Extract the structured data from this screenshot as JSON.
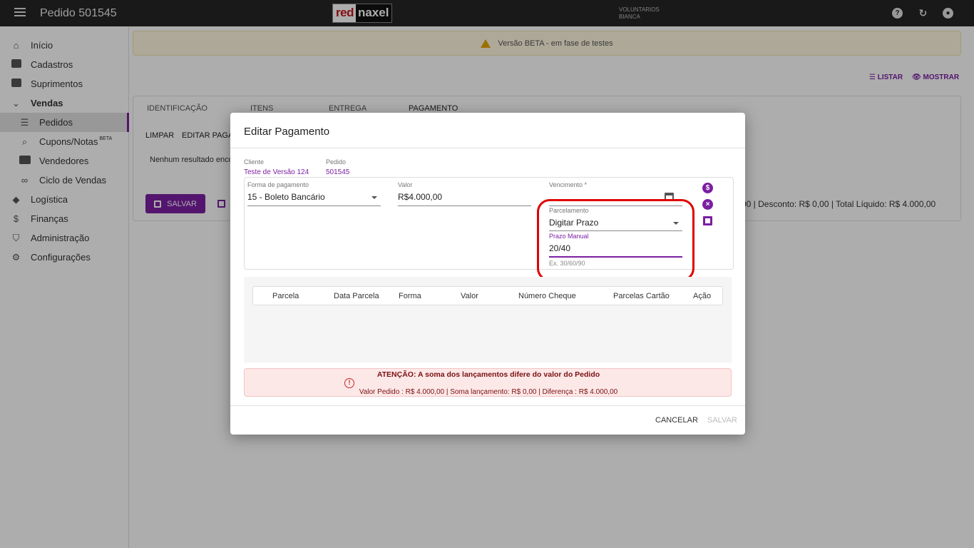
{
  "header": {
    "title": "Pedido 501545",
    "logo_red": "red",
    "logo_naxel": "naxel",
    "user_org": "VOLUNTARIOS",
    "user_name": "BIANCA",
    "icons": [
      "help-icon",
      "refresh-icon",
      "account-icon"
    ]
  },
  "sidebar": {
    "items": [
      {
        "label": "Início"
      },
      {
        "label": "Cadastros"
      },
      {
        "label": "Suprimentos"
      },
      {
        "label": "Vendas"
      },
      {
        "label": "Pedidos"
      },
      {
        "label": "Cupons/Notas",
        "badge": "BETA"
      },
      {
        "label": "Vendedores"
      },
      {
        "label": "Ciclo de Vendas"
      },
      {
        "label": "Logística"
      },
      {
        "label": "Finanças"
      },
      {
        "label": "Administração"
      },
      {
        "label": "Configurações"
      }
    ]
  },
  "banner": {
    "text": "Versão BETA - em fase de testes"
  },
  "actions": {
    "listar": "LISTAR",
    "mostrar": "MOSTRAR"
  },
  "tabs": [
    "IDENTIFICAÇÃO",
    "ITENS",
    "ENTREGA",
    "PAGAMENTO"
  ],
  "subactions": {
    "limpar": "LIMPAR",
    "editar": "EDITAR PAGA"
  },
  "main": {
    "no_result": "Nenhum resultado enco",
    "save_label": "SALVAR",
    "totals": "00 | Desconto: R$ 0,00 | Total Líquido: R$ 4.000,00"
  },
  "modal": {
    "title": "Editar Pagamento",
    "cliente_label": "Cliente",
    "cliente_value": "Teste de Versão 124",
    "pedido_label": "Pedido",
    "pedido_value": "501545",
    "forma_label": "Forma de pagamento",
    "forma_value": "15 - Boleto Bancário",
    "valor_label": "Valor",
    "valor_value": "R$4.000,00",
    "vencimento_label": "Vencimento *",
    "parcelamento_label": "Parcelamento",
    "parcelamento_value": "Digitar Prazo",
    "prazo_label": "Prazo Manual",
    "prazo_value": "20/40",
    "prazo_hint": "Ex. 30/60/90",
    "columns": [
      "Parcela",
      "Data Parcela",
      "Forma",
      "Valor",
      "Número Cheque",
      "Parcelas Cartão",
      "Ação"
    ],
    "alert_title": "ATENÇÃO: A soma dos lançamentos difere do valor do Pedido",
    "alert_text": "Valor Pedido : R$ 4.000,00 | Soma lançamento: R$ 0,00 | Diferença : R$ 4.000,00",
    "cancel_label": "CANCELAR",
    "save_label": "SALVAR"
  },
  "colors": {
    "accent": "#7b1fa2",
    "topbar": "#262626",
    "highlight": "#e00000",
    "alert_bg": "#fde8e8"
  }
}
